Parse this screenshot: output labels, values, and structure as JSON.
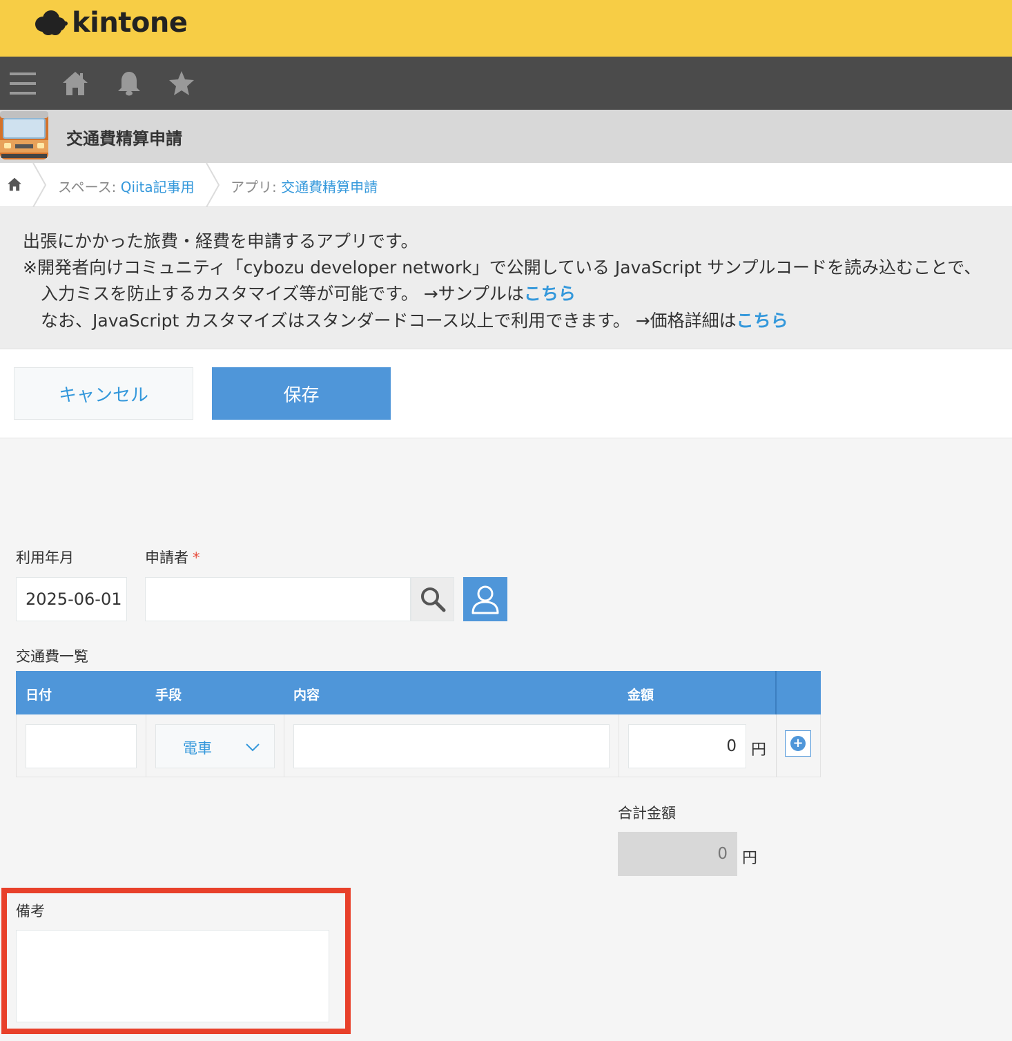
{
  "brand": {
    "logo_text": "kintone"
  },
  "nav": {
    "icons": [
      "menu-icon",
      "home-icon",
      "bell-icon",
      "star-icon"
    ]
  },
  "app": {
    "title": "交通費精算申請"
  },
  "breadcrumb": {
    "space_prefix": "スペース: ",
    "space_name": "Qiita記事用",
    "app_prefix": "アプリ: ",
    "app_name": "交通費精算申請"
  },
  "description": {
    "line1": "出張にかかった旅費・経費を申請するアプリです。",
    "line2": "※開発者向けコミュニティ「cybozu developer network」で公開している JavaScript サンプルコードを読み込むことで、",
    "line3_text": "入力ミスを防止するカスタマイズ等が可能です。 →サンプルは",
    "line3_link": "こちら",
    "line4_text": "なお、JavaScript カスタマイズはスタンダードコース以上で利用できます。 →価格詳細は",
    "line4_link": "こちら"
  },
  "toolbar": {
    "cancel_label": "キャンセル",
    "save_label": "保存"
  },
  "form": {
    "month_label": "利用年月",
    "month_value": "2025-06-01",
    "applicant_label": "申請者",
    "required_mark": "*",
    "applicant_value": "",
    "table_label": "交通費一覧",
    "columns": [
      "日付",
      "手段",
      "内容",
      "金額"
    ],
    "row": {
      "date": "",
      "method": "電車",
      "content": "",
      "amount": "0",
      "unit": "円"
    },
    "total_label": "合計金額",
    "total_value": "0",
    "total_unit": "円",
    "notes_label": "備考",
    "notes_value": ""
  },
  "colors": {
    "header_yellow": "#f7cd45",
    "nav_dark": "#4b4b4b",
    "accent_blue": "#4f96d9",
    "highlight_red": "#e8402a"
  }
}
